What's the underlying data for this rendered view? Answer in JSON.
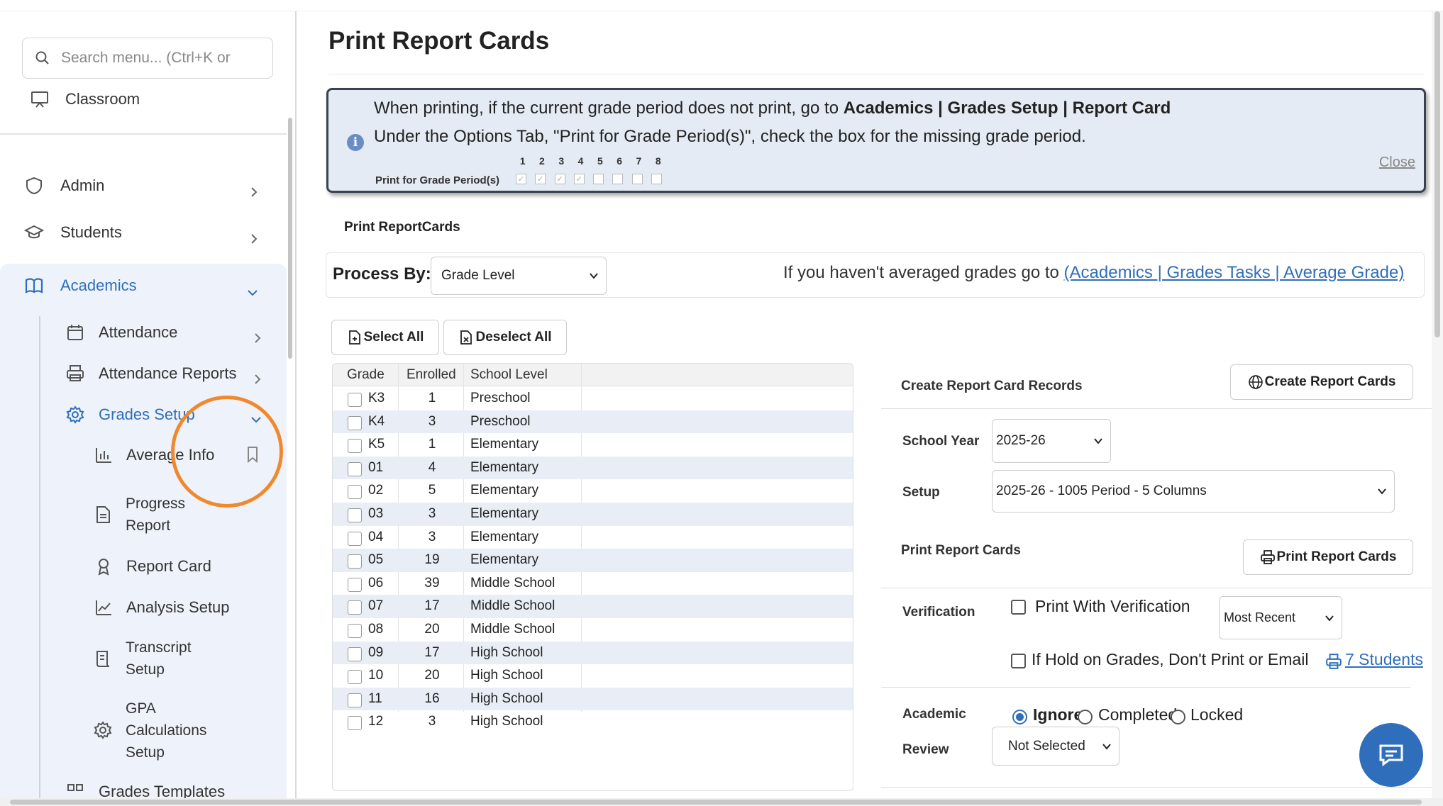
{
  "sidebar": {
    "search_placeholder": "Search menu... (Ctrl+K or",
    "classroom": "Classroom",
    "admin": "Admin",
    "students": "Students",
    "academics": "Academics",
    "attendance": "Attendance",
    "attendance_reports": "Attendance Reports",
    "grades_setup": "Grades Setup",
    "average_info": "Average Info",
    "progress_report_1": "Progress",
    "progress_report_2": "Report",
    "report_card": "Report Card",
    "analysis_setup": "Analysis Setup",
    "transcript_setup_1": "Transcript",
    "transcript_setup_2": "Setup",
    "gpa_1": "GPA",
    "gpa_2": "Calculations",
    "gpa_3": "Setup",
    "grades_templates": "Grades Templates"
  },
  "page": {
    "title": "Print Report Cards"
  },
  "notice": {
    "line1_prefix": "When printing, if the current grade period does not print, go to ",
    "line1_bold": "Academics | Grades Setup | Report Card",
    "line2": "Under the Options Tab, \"Print for Grade Period(s)\", check the box for the missing grade period.",
    "mini_label": "Print for Grade Period(s)",
    "mini_numbers": [
      "1",
      "2",
      "3",
      "4",
      "5",
      "6",
      "7",
      "8"
    ],
    "close": "Close"
  },
  "section": {
    "print_reportcards": "Print ReportCards"
  },
  "process": {
    "label": "Process By:",
    "selected": "Grade Level",
    "hint_prefix": "If you haven't averaged grades go to ",
    "hint_link": "(Academics | Grades Tasks | Average Grade)"
  },
  "buttons": {
    "select_all": "Select All",
    "deselect_all": "Deselect All",
    "create_report_cards": "Create Report Cards",
    "print_report_cards": "Print Report Cards"
  },
  "grid": {
    "headers": [
      "Grade",
      "Enrolled",
      "School Level"
    ],
    "rows": [
      {
        "grade": "K3",
        "enrolled": "1",
        "level": "Preschool"
      },
      {
        "grade": "K4",
        "enrolled": "3",
        "level": "Preschool"
      },
      {
        "grade": "K5",
        "enrolled": "1",
        "level": "Elementary"
      },
      {
        "grade": "01",
        "enrolled": "4",
        "level": "Elementary"
      },
      {
        "grade": "02",
        "enrolled": "5",
        "level": "Elementary"
      },
      {
        "grade": "03",
        "enrolled": "3",
        "level": "Elementary"
      },
      {
        "grade": "04",
        "enrolled": "3",
        "level": "Elementary"
      },
      {
        "grade": "05",
        "enrolled": "19",
        "level": "Elementary"
      },
      {
        "grade": "06",
        "enrolled": "39",
        "level": "Middle School"
      },
      {
        "grade": "07",
        "enrolled": "17",
        "level": "Middle School"
      },
      {
        "grade": "08",
        "enrolled": "20",
        "level": "Middle School"
      },
      {
        "grade": "09",
        "enrolled": "17",
        "level": "High School"
      },
      {
        "grade": "10",
        "enrolled": "20",
        "level": "High School"
      },
      {
        "grade": "11",
        "enrolled": "16",
        "level": "High School"
      },
      {
        "grade": "12",
        "enrolled": "3",
        "level": "High School"
      }
    ]
  },
  "records": {
    "create_heading": "Create Report Card Records",
    "school_year_label": "School Year",
    "school_year": "2025-26",
    "setup_label": "Setup",
    "setup": "2025-26 - 1005 Period - 5 Columns",
    "print_heading": "Print Report Cards",
    "verification_label": "Verification",
    "print_with_verification": "Print With Verification",
    "most_recent": "Most Recent",
    "hold_text": "If Hold on Grades, Don't Print or Email",
    "students_link": "7 Students",
    "academic_label": "Academic",
    "review_label": "Review",
    "ignore": "Ignore",
    "completed": "Completed",
    "locked": "Locked",
    "not_selected": "Not Selected"
  }
}
